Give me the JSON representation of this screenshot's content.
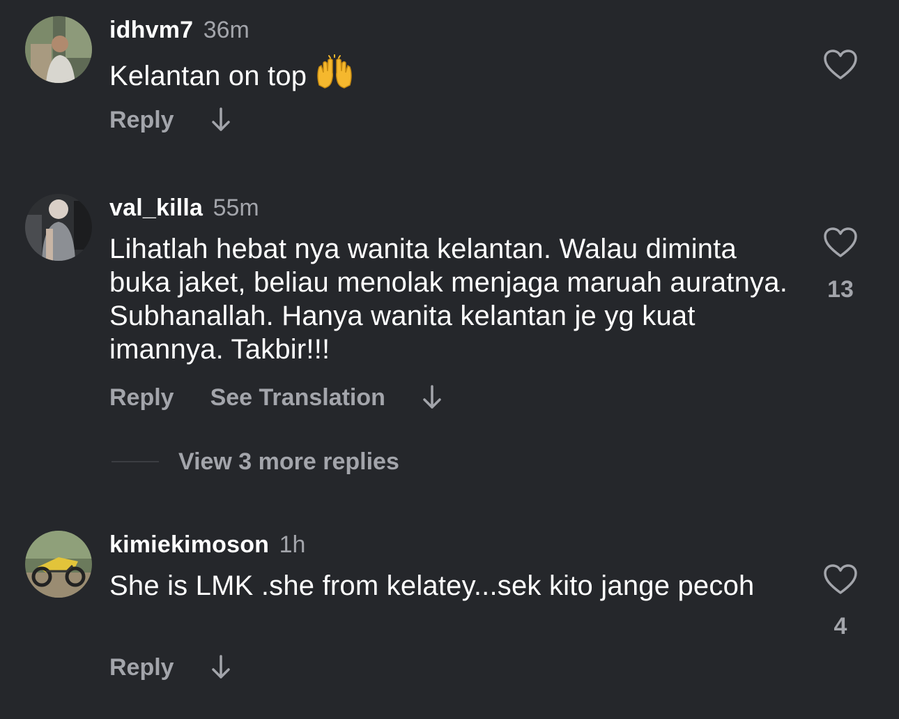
{
  "comments": [
    {
      "username": "idhvm7",
      "time": "36m",
      "text": "Kelantan on top",
      "emoji": "raising-hands-emoji",
      "actions": [
        "Reply"
      ],
      "likes": ""
    },
    {
      "username": "val_killa",
      "time": "55m",
      "text": "Lihatlah hebat nya wanita kelantan. Walau diminta buka jaket, beliau menolak menjaga maruah auratnya. Subhanallah. Hanya wanita kelantan je yg kuat imannya. Takbir!!!",
      "actions": [
        "Reply",
        "See Translation"
      ],
      "likes": "13",
      "view_more": "View 3 more replies"
    },
    {
      "username": "kimiekimoson",
      "time": "1h",
      "text": "She is LMK .she from kelatey...sek kito jange pecoh",
      "actions": [
        "Reply"
      ],
      "likes": "4"
    }
  ],
  "icons": {
    "like": "heart-outline-icon",
    "expand": "arrow-down-icon"
  },
  "colors": {
    "background": "#25272b",
    "primary_text": "#ffffff",
    "secondary_text": "#a3a5ab"
  }
}
